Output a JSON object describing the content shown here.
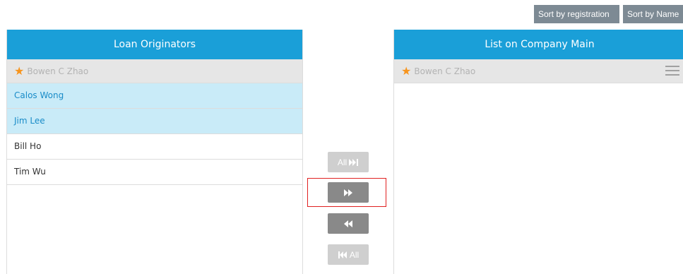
{
  "toolbar": {
    "sort_registration_label": "Sort by registration",
    "sort_name_label": "Sort by Name"
  },
  "left_panel": {
    "title": "Loan Originators",
    "pinned_item": "Bowen C Zhao",
    "items": [
      {
        "label": "Calos Wong",
        "selected": true
      },
      {
        "label": "Jim Lee",
        "selected": true
      },
      {
        "label": "Bill Ho",
        "selected": false
      },
      {
        "label": "Tim Wu",
        "selected": false
      }
    ]
  },
  "right_panel": {
    "title": "List on Company Main",
    "pinned_item": "Bowen C Zhao"
  },
  "transfer_buttons": {
    "move_all_right_label": "All",
    "move_all_left_label": "All"
  },
  "colors": {
    "header": "#1a9fd8",
    "selected_row": "#c9ebf8",
    "star": "#f7941d",
    "highlight": "#e02020"
  }
}
